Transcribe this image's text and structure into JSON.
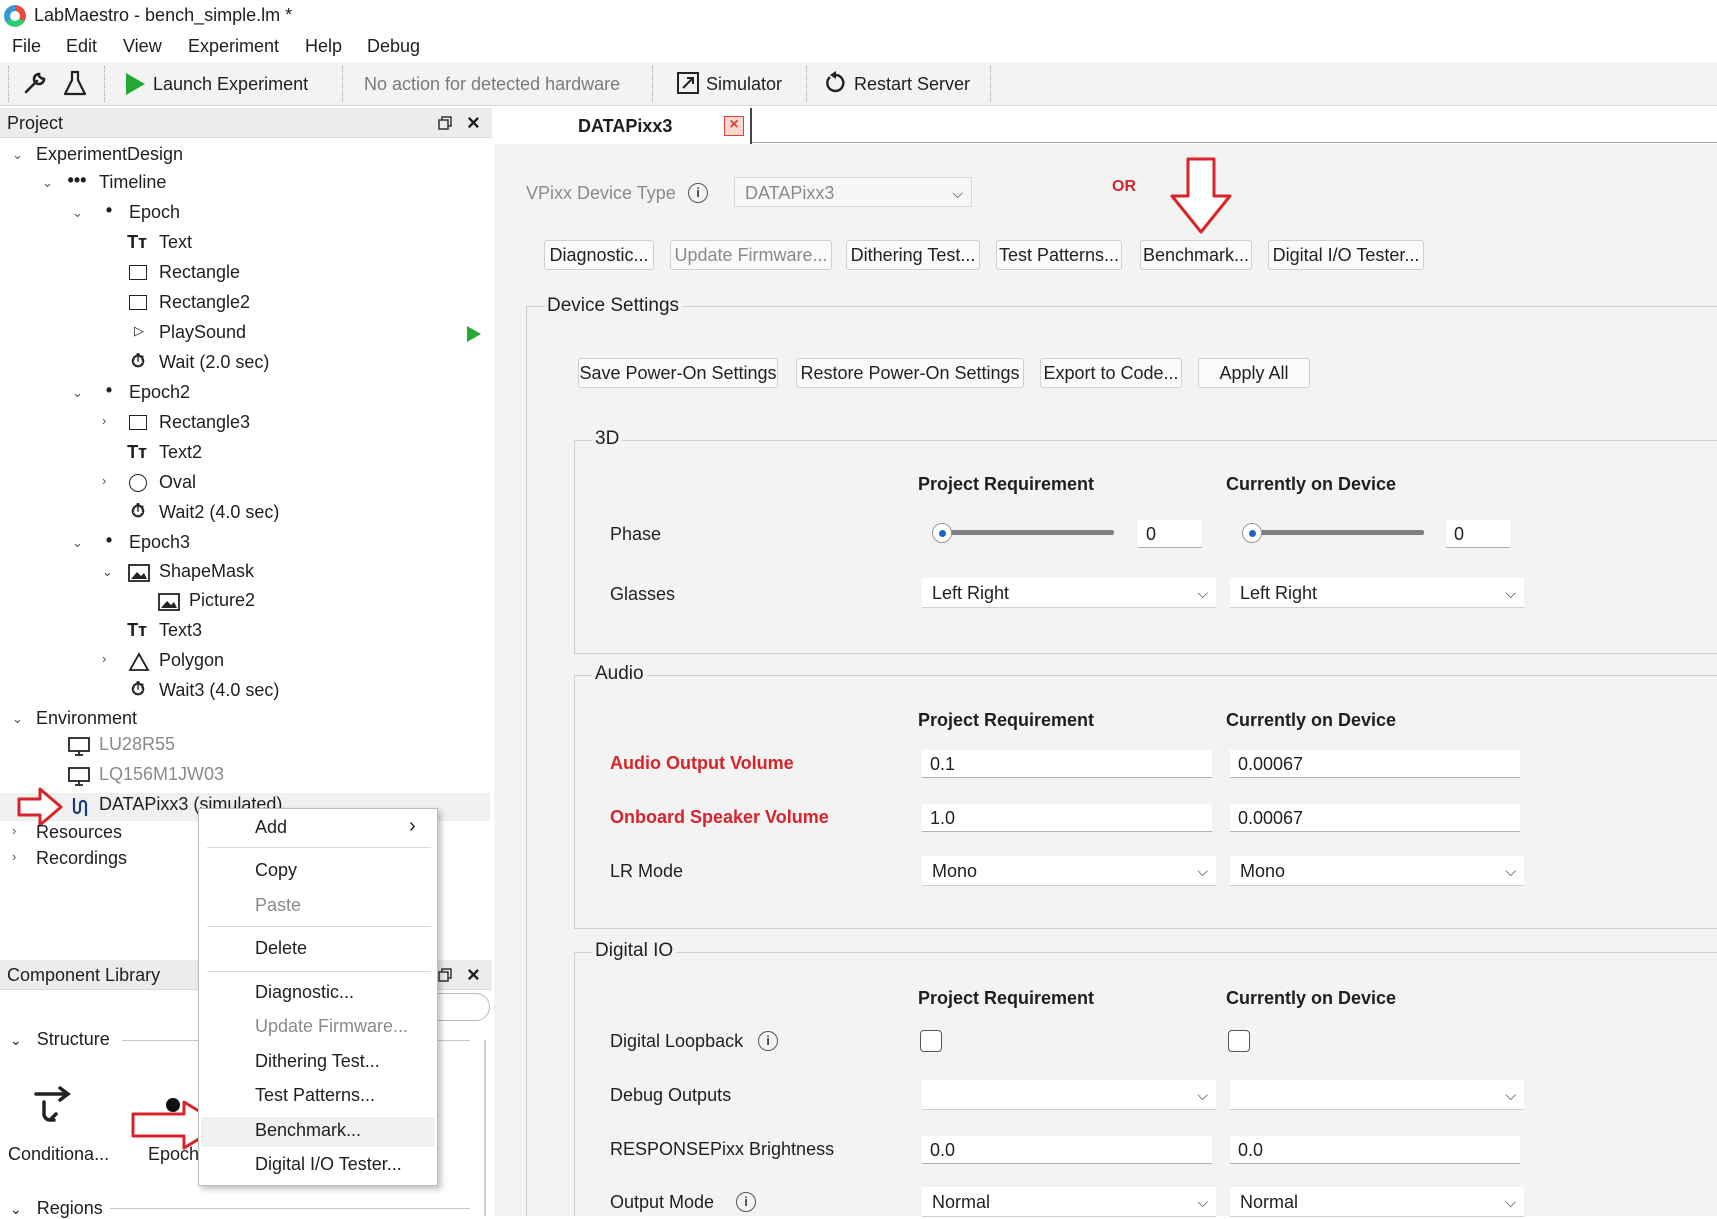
{
  "window": {
    "title": "LabMaestro - bench_simple.lm *"
  },
  "menu": [
    "File",
    "Edit",
    "View",
    "Experiment",
    "Help",
    "Debug"
  ],
  "toolbar": {
    "launch_label": "Launch Experiment",
    "status_text": "No action for detected hardware",
    "simulator_label": "Simulator",
    "restart_label": "Restart Server"
  },
  "project_panel": {
    "title": "Project",
    "tree": {
      "experiment_design": "ExperimentDesign",
      "timeline": "Timeline",
      "epoch": "Epoch",
      "text": "Text",
      "rectangle": "Rectangle",
      "rectangle2": "Rectangle2",
      "playsound": "PlaySound",
      "wait": "Wait (2.0 sec)",
      "epoch2": "Epoch2",
      "rectangle3": "Rectangle3",
      "text2": "Text2",
      "oval": "Oval",
      "wait2": "Wait2 (4.0 sec)",
      "epoch3": "Epoch3",
      "shapemask": "ShapeMask",
      "picture2": "Picture2",
      "text3": "Text3",
      "polygon": "Polygon",
      "wait3": "Wait3 (4.0 sec)",
      "environment": "Environment",
      "monitor1": "LU28R55",
      "monitor2": "LQ156M1JW03",
      "datapixx": "DATAPixx3 (simulated)",
      "resources": "Resources",
      "recordings": "Recordings"
    }
  },
  "component_library": {
    "title": "Component Library",
    "structure_label": "Structure",
    "items": [
      "Conditiona...",
      "Epoch"
    ],
    "regions_label": "Regions"
  },
  "context_menu": {
    "items": [
      "Add",
      "Copy",
      "Paste",
      "Delete",
      "Diagnostic...",
      "Update Firmware...",
      "Dithering Test...",
      "Test Patterns...",
      "Benchmark...",
      "Digital I/O Tester..."
    ]
  },
  "tab": {
    "title": "DATAPixx3"
  },
  "device": {
    "type_label": "VPixx Device Type",
    "type_value": "DATAPixx3",
    "or_annotation": "OR",
    "buttons": [
      "Diagnostic...",
      "Update Firmware...",
      "Dithering Test...",
      "Test Patterns...",
      "Benchmark...",
      "Digital I/O Tester..."
    ],
    "settings_title": "Device Settings",
    "settings_buttons": [
      "Save Power-On Settings",
      "Restore Power-On Settings",
      "Export to Code...",
      "Apply All"
    ],
    "col_project": "Project Requirement",
    "col_device": "Currently on Device",
    "group_3d": {
      "title": "3D",
      "phase_label": "Phase",
      "phase_project": "0",
      "phase_device": "0",
      "glasses_label": "Glasses",
      "glasses_project": "Left Right",
      "glasses_device": "Left Right"
    },
    "group_audio": {
      "title": "Audio",
      "output_label": "Audio Output Volume",
      "output_project": "0.1",
      "output_device": "0.00067",
      "speaker_label": "Onboard Speaker Volume",
      "speaker_project": "1.0",
      "speaker_device": "0.00067",
      "lr_label": "LR Mode",
      "lr_project": "Mono",
      "lr_device": "Mono"
    },
    "group_dio": {
      "title": "Digital IO",
      "loopback_label": "Digital Loopback",
      "debug_label": "Debug Outputs",
      "debug_project": "",
      "debug_device": "",
      "brightness_label": "RESPONSEPixx Brightness",
      "brightness_project": "0.0",
      "brightness_device": "0.0",
      "output_mode_label": "Output Mode",
      "output_mode_project": "Normal",
      "output_mode_device": "Normal"
    }
  },
  "colors": {
    "accent_red": "#d8232a",
    "play_green": "#22aa33",
    "slider_blue": "#1a64c8"
  }
}
